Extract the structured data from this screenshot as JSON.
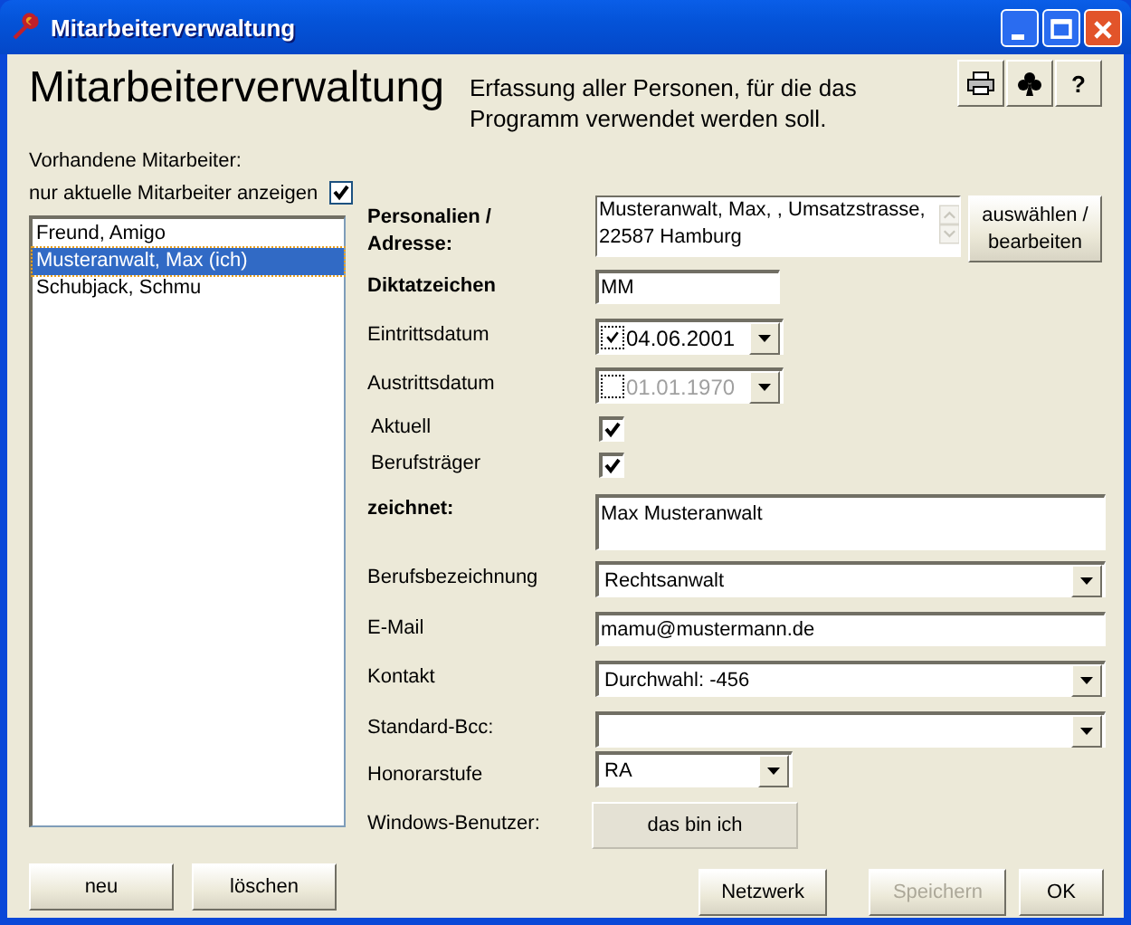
{
  "window": {
    "title": "Mitarbeiterverwaltung"
  },
  "header": {
    "title": "Mitarbeiterverwaltung",
    "description": "Erfassung aller Personen, für die das Programm verwendet werden soll.",
    "help_button": "?"
  },
  "employees": {
    "label": "Vorhandene Mitarbeiter:",
    "filter_label": "nur aktuelle Mitarbeiter anzeigen",
    "filter_checked": true,
    "items": [
      {
        "name": "Freund, Amigo",
        "selected": false
      },
      {
        "name": "Musteranwalt, Max  (ich)",
        "selected": true
      },
      {
        "name": "Schubjack, Schmu",
        "selected": false
      }
    ],
    "buttons": [
      "neu",
      "löschen"
    ]
  },
  "form": [
    {
      "kind": "address",
      "label": "Personalien / Adresse:",
      "bold": true,
      "value": "Musteranwalt, Max, , Umsatzstrasse, 22587 Hamburg",
      "button": "auswählen / bearbeiten"
    },
    {
      "kind": "text",
      "label": "Diktatzeichen",
      "bold": true,
      "value": "MM"
    },
    {
      "kind": "date",
      "label": "Eintrittsdatum",
      "bold": false,
      "value": "04.06.2001",
      "checked": true
    },
    {
      "kind": "date",
      "label": "Austrittsdatum",
      "bold": false,
      "value": "01.01.1970",
      "checked": false
    },
    {
      "kind": "checkbox",
      "label": "Aktuell",
      "bold": false,
      "checked": true
    },
    {
      "kind": "checkbox",
      "label": "Berufsträger",
      "bold": false,
      "checked": true
    },
    {
      "kind": "textarea",
      "label": "zeichnet:",
      "bold": true,
      "value": "Max Musteranwalt"
    },
    {
      "kind": "select",
      "label": "Berufsbezeichnung",
      "bold": false,
      "value": "Rechtsanwalt"
    },
    {
      "kind": "text",
      "label": "E-Mail",
      "bold": false,
      "value": "mamu@mustermann.de"
    },
    {
      "kind": "select",
      "label": "Kontakt",
      "bold": false,
      "value": "Durchwahl: -456"
    },
    {
      "kind": "select",
      "label": "Standard-Bcc:",
      "bold": false
    },
    {
      "kind": "smallselect",
      "label": "Honorarstufe",
      "bold": false,
      "value": "RA"
    },
    {
      "kind": "button",
      "label": "Windows-Benutzer:",
      "bold": false,
      "value": "das bin ich"
    }
  ],
  "buttons": [
    {
      "label": "Netzwerk",
      "disabled": false
    },
    {
      "label": "Speichern",
      "disabled": true
    },
    {
      "label": "OK",
      "disabled": false
    }
  ]
}
